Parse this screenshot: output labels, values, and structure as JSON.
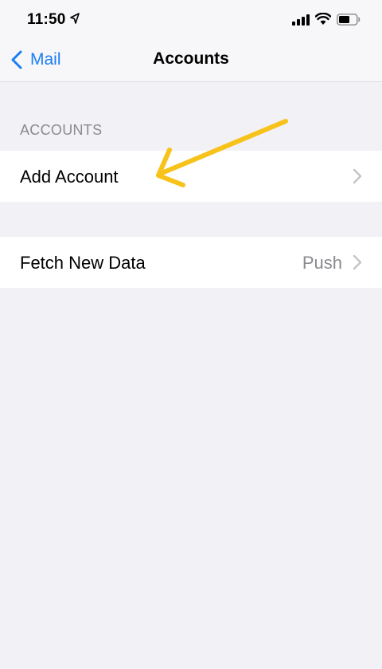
{
  "status_bar": {
    "time": "11:50",
    "icons": [
      "location-arrow-icon",
      "cellular-signal-icon",
      "wifi-icon",
      "battery-icon"
    ]
  },
  "nav": {
    "back_label": "Mail",
    "title": "Accounts"
  },
  "sections": [
    {
      "header": "ACCOUNTS",
      "rows": [
        {
          "label": "Add Account",
          "value": ""
        }
      ]
    },
    {
      "header": "",
      "rows": [
        {
          "label": "Fetch New Data",
          "value": "Push"
        }
      ]
    }
  ],
  "colors": {
    "accent": "#1a7df5",
    "background": "#f2f1f6",
    "annotation_arrow": "#f7c21a"
  }
}
